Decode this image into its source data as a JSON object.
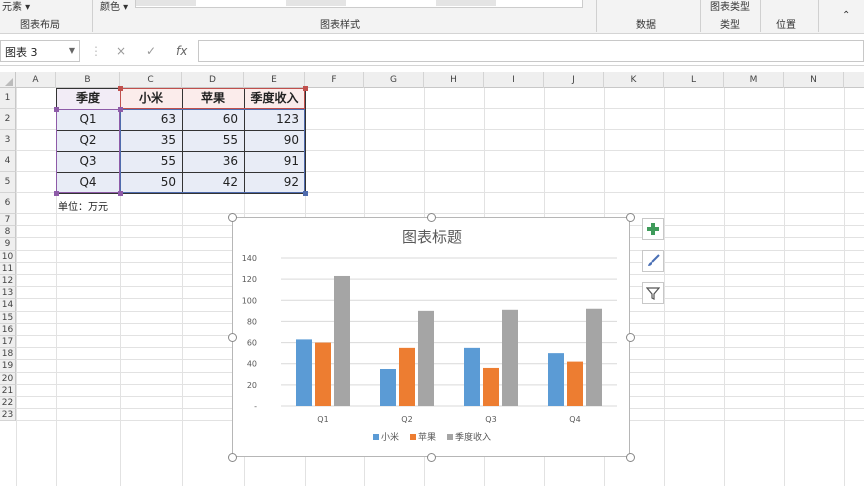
{
  "ribbon": {
    "left_item": "元素",
    "color_label": "颜色",
    "groups": [
      "图表布局",
      "图表样式",
      "数据",
      "类型",
      "位置"
    ],
    "change_type_label": "图表类型"
  },
  "formula_bar": {
    "name_box": "图表 3",
    "cancel_symbol": "×",
    "confirm_symbol": "✓",
    "fx_symbol": "fx"
  },
  "grid": {
    "columns": [
      "A",
      "B",
      "C",
      "D",
      "E",
      "F",
      "G",
      "H",
      "I",
      "J",
      "K",
      "L",
      "M",
      "N"
    ],
    "rows": [
      "1",
      "2",
      "3",
      "4",
      "5",
      "6",
      "7",
      "8",
      "9",
      "10",
      "11",
      "12",
      "13",
      "14",
      "15",
      "16",
      "17",
      "18",
      "19",
      "20",
      "21",
      "22",
      "23"
    ]
  },
  "table": {
    "headers": [
      "季度",
      "小米",
      "苹果",
      "季度收入"
    ],
    "rows": [
      [
        "Q1",
        "63",
        "60",
        "123"
      ],
      [
        "Q2",
        "35",
        "55",
        "90"
      ],
      [
        "Q3",
        "55",
        "36",
        "91"
      ],
      [
        "Q4",
        "50",
        "42",
        "92"
      ]
    ],
    "note": "单位：万元"
  },
  "chart_data": {
    "type": "bar",
    "title": "图表标题",
    "categories": [
      "Q1",
      "Q2",
      "Q3",
      "Q4"
    ],
    "series": [
      {
        "name": "小米",
        "values": [
          63,
          35,
          55,
          50
        ],
        "color": "#5b9bd5"
      },
      {
        "name": "苹果",
        "values": [
          60,
          55,
          36,
          42
        ],
        "color": "#ed7d31"
      },
      {
        "name": "季度收入",
        "values": [
          123,
          90,
          91,
          92
        ],
        "color": "#a5a5a5"
      }
    ],
    "y_ticks": [
      "-",
      "20",
      "40",
      "60",
      "80",
      "100",
      "120",
      "140"
    ],
    "ylim": [
      0,
      140
    ],
    "grid": true,
    "legend_position": "bottom"
  },
  "chart_buttons": {
    "elements": "chart-elements-plus-icon",
    "styles": "chart-styles-brush-icon",
    "filters": "chart-filter-icon"
  }
}
